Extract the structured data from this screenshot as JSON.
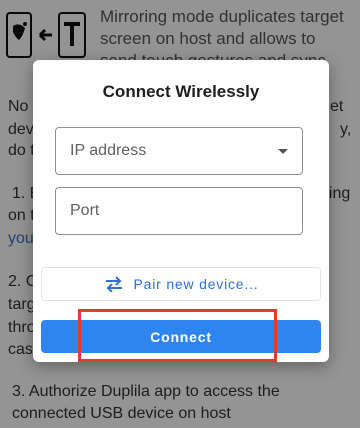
{
  "header": {
    "description": "Mirroring mode duplicates target screen on host and allows to send touch gestures and sync clipboard"
  },
  "background_text": {
    "p1_line1": "No t",
    "p1_line1_end": "et",
    "p1_line2": "dev",
    "p1_line2_end": "y,",
    "p1_line3": "do t",
    "step1_start": "1. E",
    "step1_end": "ging",
    "step1_line2": "on t",
    "step1_link": "you",
    "step2_start": "2. C",
    "step2_line2": "targ",
    "step2_line3": "thro",
    "step2_line4": "cas",
    "step3": "3. Authorize Duplila app to access the connected USB device on host"
  },
  "dialog": {
    "title": "Connect Wirelessly",
    "ip_placeholder": "IP address",
    "port_placeholder": "Port",
    "pair_label": "Pair new device...",
    "connect_label": "Connect"
  },
  "colors": {
    "accent": "#2f86f1",
    "link": "#2f6fdc",
    "highlight": "#e53b2f"
  },
  "icons": {
    "pair": "swap-arrows-icon",
    "dropdown": "chevron-down-icon"
  }
}
